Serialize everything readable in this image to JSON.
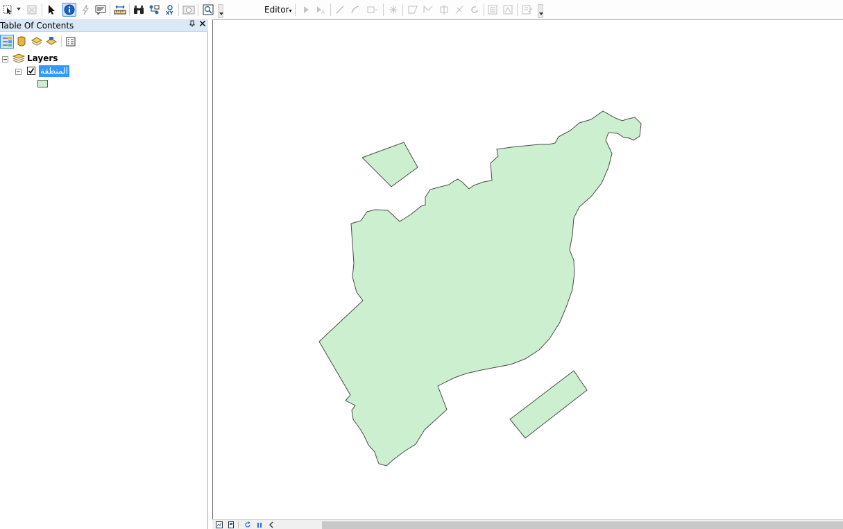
{
  "toolbar": {
    "icons": [
      "select-elements-icon",
      "disabled-tool-icon",
      "select-arrow-icon",
      "identify-icon",
      "hyperlink-icon",
      "html-popup-icon",
      "measure-icon",
      "find-icon",
      "find-route-icon",
      "go-to-xy-icon",
      "time-slider-icon",
      "create-viewer-icon"
    ],
    "editor_label": "Editor",
    "editor_caret": "▾"
  },
  "toc": {
    "title": "Table Of Contents",
    "pin": "ᵖ",
    "close": "✕",
    "tools": [
      "list-by-drawing-order-icon",
      "list-by-source-icon",
      "list-by-visibility-icon",
      "list-by-selection-icon",
      "options-icon"
    ],
    "root_label": "Layers",
    "layer_name": "المنطقة",
    "layer_checked": true,
    "layer_fill_color": "#ccf0cf"
  },
  "map": {
    "polygon_fill": "#ccf0cf",
    "polygon_stroke": "#4a4a4a",
    "features": [
      "main-region",
      "northwest-parcel",
      "southeast-parcel"
    ]
  },
  "bottom_bar": {
    "icons": [
      "data-view-icon",
      "layout-view-icon",
      "refresh-icon",
      "pause-drawing-icon",
      "scroll-left-icon"
    ]
  }
}
